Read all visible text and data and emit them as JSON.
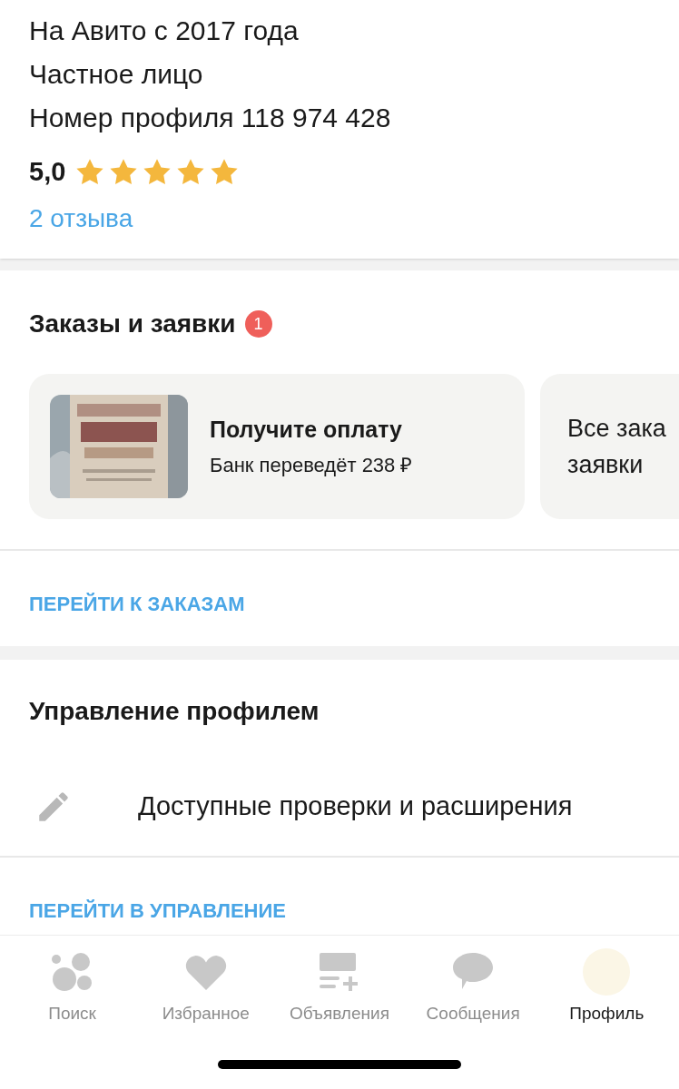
{
  "profile": {
    "lines": [
      "На Авито с 2017 года",
      "Частное лицо",
      "Номер профиля 118 974 428"
    ],
    "rating": "5,0",
    "stars": 5,
    "reviews_link": "2 отзыва"
  },
  "orders": {
    "title": "Заказы и заявки",
    "badge": "1",
    "card": {
      "title": "Получите оплату",
      "subtitle": "Банк переведёт 238 ₽"
    },
    "all_card": {
      "lines": [
        "Все зака",
        "заявки"
      ]
    },
    "link": "ПЕРЕЙТИ К ЗАКАЗАМ"
  },
  "management": {
    "title": "Управление профилем",
    "item": "Доступные проверки и расширения",
    "link": "ПЕРЕЙТИ В УПРАВЛЕНИЕ"
  },
  "nav": [
    {
      "label": "Поиск",
      "selected": false
    },
    {
      "label": "Избранное",
      "selected": false
    },
    {
      "label": "Объявления",
      "selected": false
    },
    {
      "label": "Сообщения",
      "selected": false
    },
    {
      "label": "Профиль",
      "selected": true
    }
  ]
}
